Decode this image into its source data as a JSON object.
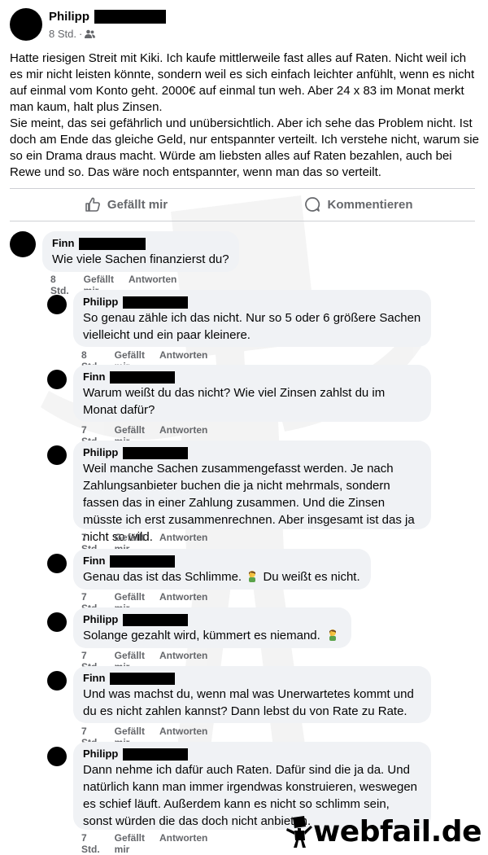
{
  "post": {
    "author": "Philipp",
    "time": "8 Std.",
    "body": [
      "Hatte riesigen Streit mit Kiki. Ich kaufe mittlerweile fast alles auf Raten. Nicht weil ich es mir nicht leisten könnte, sondern weil es sich einfach leichter anfühlt, wenn es nicht auf einmal vom Konto geht. 2000€ auf einmal tun weh. Aber 24 x 83 im Monat merkt man kaum, halt plus Zinsen.",
      "Sie meint, das sei gefährlich und unübersichtlich. Aber ich sehe das Problem nicht. Ist doch am Ende das gleiche Geld, nur entspannter verteilt. Ich verstehe nicht, warum sie so ein Drama draus macht. Würde am liebsten alles auf Raten bezahlen, auch bei Rewe und so. Das wäre noch entspannter, wenn man das so verteilt."
    ],
    "like_label": "Gefällt mir",
    "comment_label": "Kommentieren"
  },
  "comment_labels": {
    "like": "Gefällt mir",
    "reply": "Antworten"
  },
  "comments": [
    {
      "author": "Finn",
      "time": "8 Std.",
      "text": "Wie viele Sachen finanzierst du?"
    },
    {
      "author": "Philipp",
      "time": "8 Std.",
      "text": "So genau zähle ich das nicht. Nur so 5 oder 6 größere Sachen vielleicht und ein paar kleinere."
    },
    {
      "author": "Finn",
      "time": "7 Std.",
      "text": "Warum weißt du das nicht? Wie viel Zinsen zahlst du im Monat dafür?"
    },
    {
      "author": "Philipp",
      "time": "7 Std.",
      "text": "Weil manche Sachen zusammengefasst werden. Je nach Zahlungsanbieter buchen die ja nicht mehrmals, sondern fassen das in einer Zahlung zusammen. Und die Zinsen müsste ich erst zusammenrechnen. Aber insgesamt ist das ja nicht so wild."
    },
    {
      "author": "Finn",
      "time": "7 Std.",
      "text_before": "Genau das ist das Schlimme.",
      "text_after": "Du weißt es nicht."
    },
    {
      "author": "Philipp",
      "time": "7 Std.",
      "text": "Solange gezahlt wird, kümmert es niemand."
    },
    {
      "author": "Finn",
      "time": "7 Std.",
      "text": "Und was machst du, wenn mal was Unerwartetes kommt und du es nicht zahlen kannst? Dann lebst du von Rate zu Rate."
    },
    {
      "author": "Philipp",
      "time": "7 Std.",
      "text": "Dann nehme ich dafür auch Raten. Dafür sind die ja da. Und natürlich kann man immer irgendwas konstruieren, weswegen es schief läuft. Außerdem kann es nicht so schlimm sein, sonst würden die das doch nicht anbieten."
    }
  ],
  "brand": "webfail.de",
  "icons": {
    "audience": "friends-icon",
    "like": "thumbs-up-icon",
    "comment": "speech-bubble-icon",
    "emoji": "facepalm-emoji-icon"
  },
  "colors": {
    "bubble": "#f0f2f5",
    "secondary_text": "#65676b",
    "divider": "#ced0d4"
  }
}
